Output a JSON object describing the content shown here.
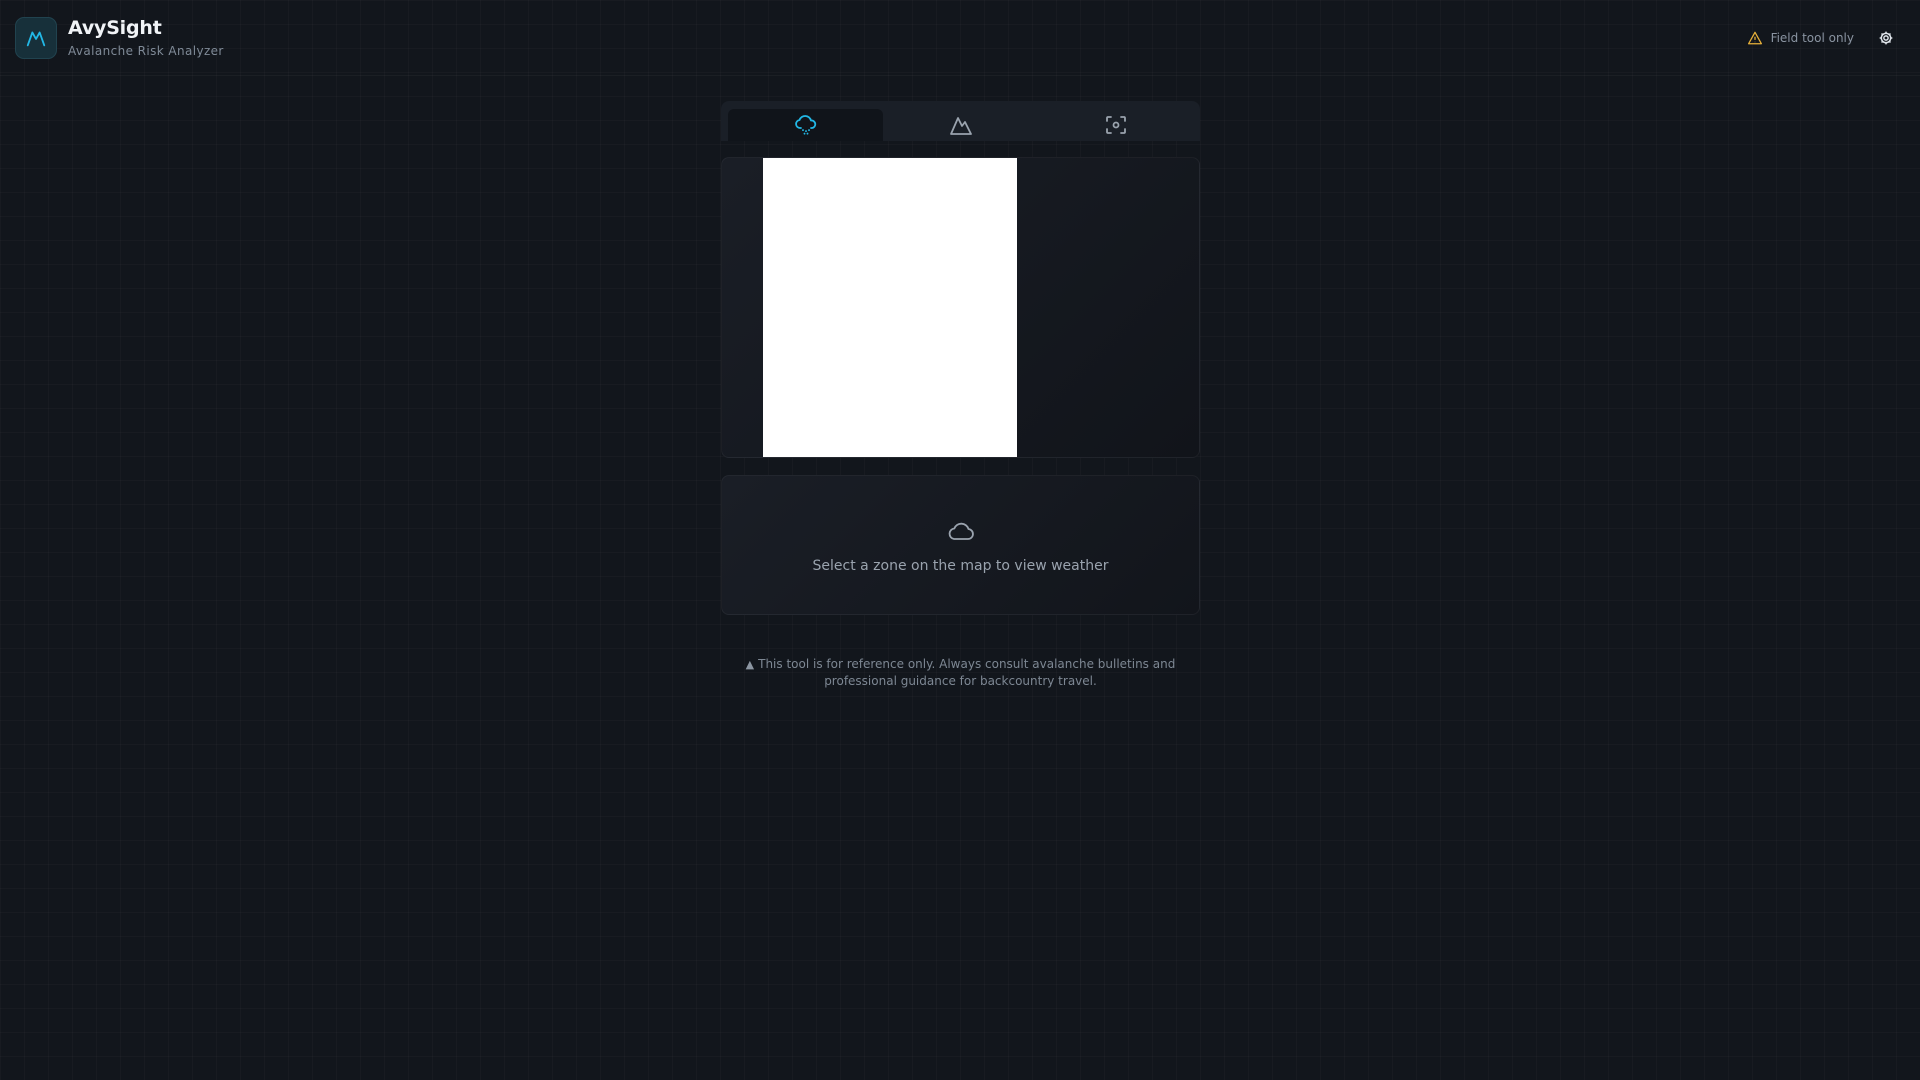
{
  "app": {
    "title": "AvySight",
    "subtitle": "Avalanche Risk Analyzer"
  },
  "header": {
    "field_tool_label": "Field tool only",
    "settings_icon": "gear-icon",
    "warning_icon": "warning-triangle-icon"
  },
  "tabs": [
    {
      "icon": "cloud-snow-icon",
      "active": true
    },
    {
      "icon": "mountain-icon",
      "active": false
    },
    {
      "icon": "camera-scan-icon",
      "active": false
    }
  ],
  "weather": {
    "icon": "cloud-icon",
    "message": "Select a zone on the map to view weather"
  },
  "footer": {
    "disclaimer": "This tool is for reference only. Always consult avalanche bulletins and professional guidance for backcountry travel."
  },
  "colors": {
    "accent": "#22b8e6",
    "warning": "#e8b13a",
    "background": "#12161c"
  }
}
